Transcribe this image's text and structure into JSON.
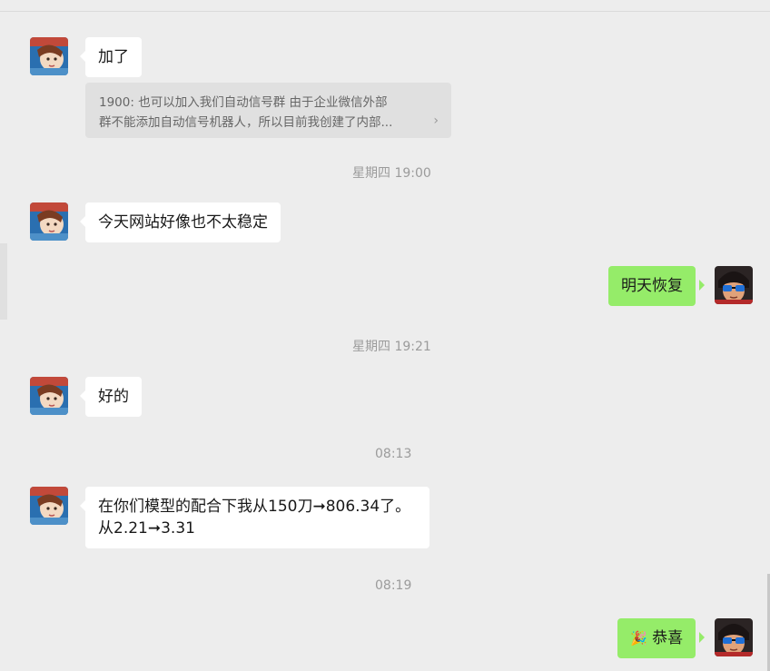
{
  "chat": {
    "messages": [
      {
        "sender": "other",
        "text": "加了"
      },
      {
        "quote_lines": [
          "1900: 也可以加入我们自动信号群 由于企业微信外部",
          "群不能添加自动信号机器人，所以目前我创建了内部..."
        ]
      },
      {
        "timestamp": "星期四 19:00"
      },
      {
        "sender": "other",
        "text": "今天网站好像也不太稳定"
      },
      {
        "sender": "self",
        "text": "明天恢复"
      },
      {
        "timestamp": "星期四 19:21"
      },
      {
        "sender": "other",
        "text": "好的"
      },
      {
        "timestamp": "08:13"
      },
      {
        "sender": "other",
        "lines": [
          "在你们模型的配合下我从150刀➞806.34了。",
          "从2.21➞3.31"
        ]
      },
      {
        "timestamp": "08:19"
      },
      {
        "sender": "self",
        "emoji": "🎉",
        "text": "恭喜"
      }
    ]
  },
  "icons": {
    "quote_chevron": "chevron-right-icon",
    "party_emoji": "party-popper-icon"
  },
  "colors": {
    "background": "#ededed",
    "incoming_bubble": "#ffffff",
    "outgoing_bubble": "#95ec69",
    "timestamp_text": "#9b9b9b",
    "quote_background": "#e0e0e0"
  }
}
